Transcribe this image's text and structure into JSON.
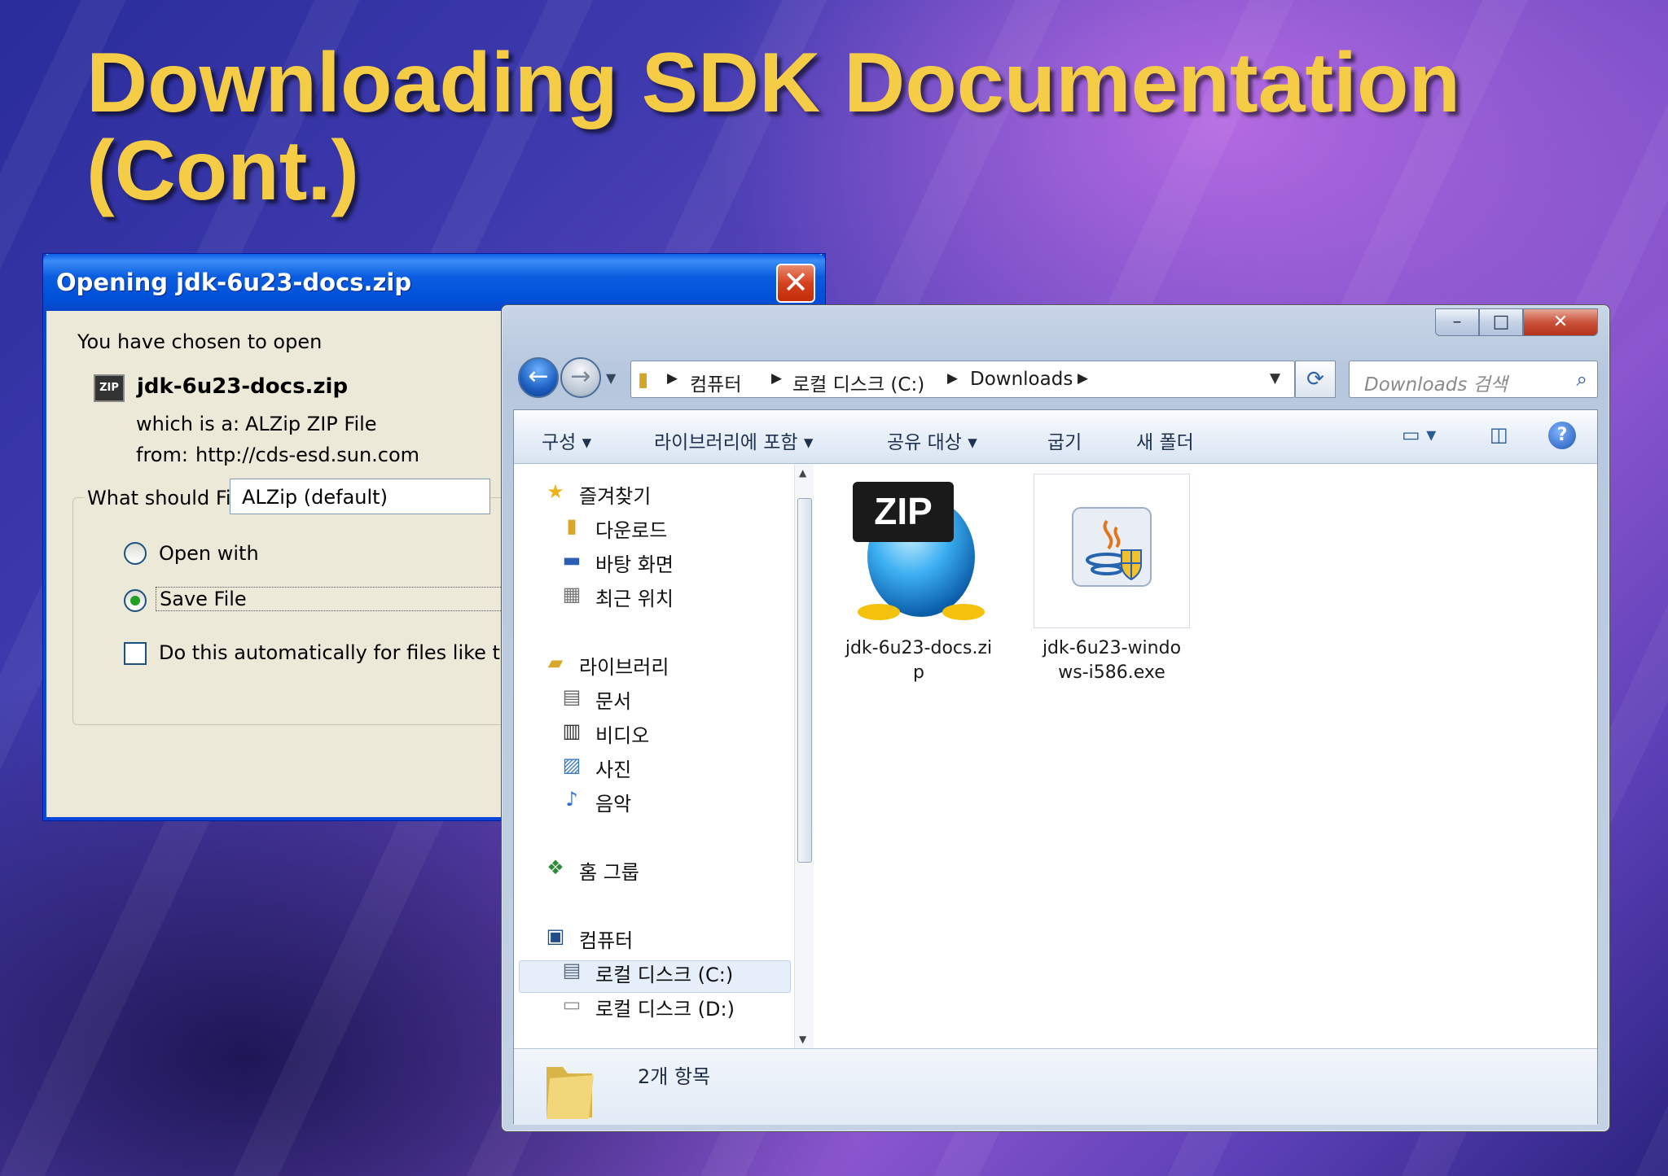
{
  "slide": {
    "title": "Downloading SDK Documentation (Cont.)"
  },
  "dialog": {
    "title": "Opening jdk-6u23-docs.zip",
    "close": "✕",
    "intro": "You have chosen to open",
    "file_icon": "ZIP",
    "filename": "jdk-6u23-docs.zip",
    "which_is_label": "which is a:",
    "which_is_value": "ALZip ZIP File",
    "from_label": "from:",
    "from_value": "http://cds-esd.sun.com",
    "question": "What should Firefox do with this file?",
    "open_with_label": "Open with",
    "open_with_value": "ALZip (default)",
    "save_file_label": "Save File",
    "auto_label": "Do this automatically for files like this",
    "selected_option": "save_file"
  },
  "explorer": {
    "caption_buttons": {
      "minimize": "–",
      "maximize": "□",
      "close": "✕"
    },
    "address": {
      "crumbs": [
        "컴퓨터",
        "로컬 디스크 (C:)",
        "Downloads"
      ]
    },
    "search_placeholder": "Downloads 검색",
    "toolbar": {
      "organize": "구성 ▾",
      "include_library": "라이브러리에 포함 ▾",
      "share": "공유 대상 ▾",
      "burn": "굽기",
      "new_folder": "새 폴더",
      "help": "?"
    },
    "nav": {
      "favorites": "즐겨찾기",
      "downloads": "다운로드",
      "desktop": "바탕 화면",
      "recent": "최근 위치",
      "libraries": "라이브러리",
      "documents": "문서",
      "videos": "비디오",
      "pictures": "사진",
      "music": "음악",
      "homegroup": "홈 그룹",
      "computer": "컴퓨터",
      "disk_c": "로컬 디스크 (C:)",
      "disk_d": "로컬 디스크 (D:)"
    },
    "files": [
      {
        "name_line1": "jdk-6u23-docs.zi",
        "name_line2": "p",
        "icon": "zip-icon",
        "badge": "ZIP"
      },
      {
        "name_line1": "jdk-6u23-windo",
        "name_line2": "ws-i586.exe",
        "icon": "java-installer-icon"
      }
    ],
    "status": "2개 항목"
  },
  "colors": {
    "title": "#f4cc46",
    "xp_titlebar": "#0a5fe8",
    "dialog_bg": "#ece9d8"
  }
}
